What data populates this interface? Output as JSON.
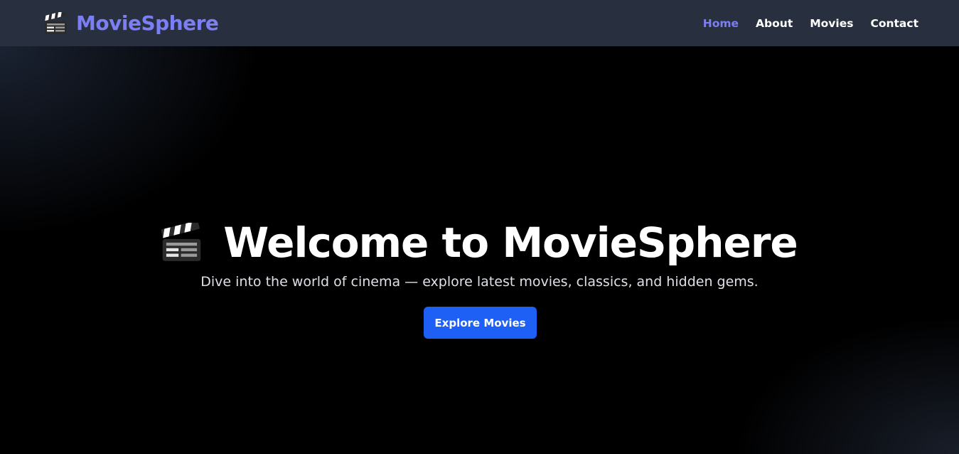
{
  "nav": {
    "brand": "MovieSphere",
    "brand_icon": "clapperboard-icon",
    "links": [
      {
        "label": "Home",
        "active": true
      },
      {
        "label": "About",
        "active": false
      },
      {
        "label": "Movies",
        "active": false
      },
      {
        "label": "Contact",
        "active": false
      }
    ]
  },
  "hero": {
    "title": "Welcome to MovieSphere",
    "title_icon": "clapperboard-icon",
    "subtitle": "Dive into the world of cinema — explore latest movies, classics, and hidden gems.",
    "cta_label": "Explore Movies"
  },
  "colors": {
    "navbar_bg": "#283040",
    "brand_accent": "#7b7ef4",
    "hero_bg": "#000000",
    "cta_bg": "#1e60f5",
    "text": "#ffffff"
  }
}
